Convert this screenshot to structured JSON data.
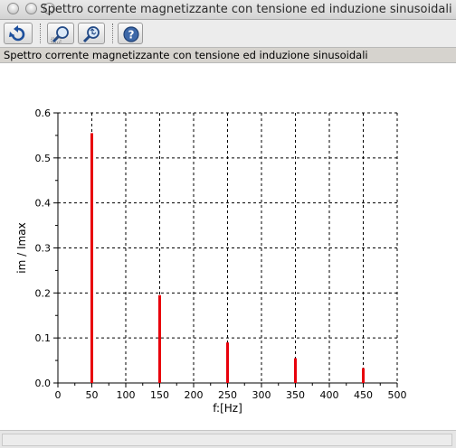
{
  "window": {
    "title": "Spettro corrente magnetizzante con tensione ed induzione sinusoidali"
  },
  "toolbar": {
    "buttons": [
      {
        "icon": "rotate-icon"
      },
      {
        "icon": "zoom-in-icon"
      },
      {
        "icon": "zoom-fit-icon"
      },
      {
        "icon": "help-icon"
      }
    ]
  },
  "header": {
    "label": "Spettro corrente magnetizzante con tensione ed induzione sinusoidali"
  },
  "chart_data": {
    "type": "bar",
    "xlabel": "f:[Hz]",
    "ylabel": "im / Imax",
    "xlim": [
      0,
      500
    ],
    "ylim": [
      0,
      0.6
    ],
    "xticks": [
      0,
      50,
      100,
      150,
      200,
      250,
      300,
      350,
      400,
      450,
      500
    ],
    "yticks": [
      0.0,
      0.1,
      0.2,
      0.3,
      0.4,
      0.5,
      0.6
    ],
    "grid": true,
    "bar_color": "#e8000b",
    "x": [
      50,
      150,
      250,
      350,
      450
    ],
    "values": [
      0.555,
      0.195,
      0.09,
      0.055,
      0.033
    ]
  }
}
